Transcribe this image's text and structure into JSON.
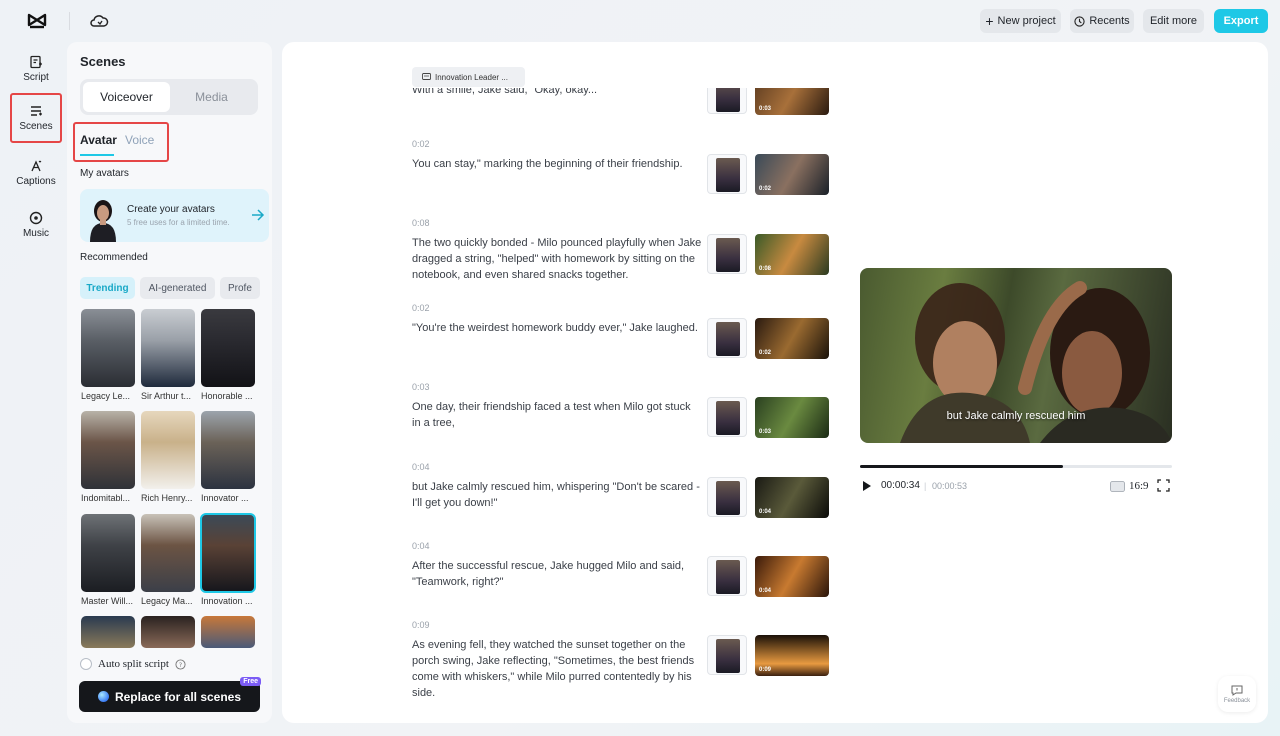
{
  "topbar": {
    "new_project": "New project",
    "recents": "Recents",
    "edit_more": "Edit more",
    "export": "Export"
  },
  "rail": {
    "script": "Script",
    "scenes": "Scenes",
    "captions": "Captions",
    "music": "Music"
  },
  "panel": {
    "title": "Scenes",
    "seg_voiceover": "Voiceover",
    "seg_media": "Media",
    "tab_avatar": "Avatar",
    "tab_voice": "Voice",
    "my_avatars": "My avatars",
    "create_title": "Create your avatars",
    "create_sub": "5 free uses for a limited time.",
    "recommended": "Recommended",
    "chips": [
      "Trending",
      "AI-generated",
      "Profe"
    ],
    "avatars": [
      "Legacy Le...",
      "Sir Arthur t...",
      "Honorable ...",
      "Indomitabl...",
      "Rich Henry...",
      "Innovator ...",
      "Master Will...",
      "Legacy Ma...",
      "Innovation ..."
    ],
    "auto_split": "Auto split script",
    "replace": "Replace for all scenes",
    "free": "Free"
  },
  "main": {
    "tag": "Innovation Leader ...",
    "scenes": [
      {
        "time": "",
        "text": "With a smile, Jake said, \"Okay, okay...",
        "dur": "0:03"
      },
      {
        "time": "0:02",
        "text": "You can stay,\" marking the beginning of their friendship.",
        "dur": "0:02"
      },
      {
        "time": "0:08",
        "text": "The two quickly bonded - Milo pounced playfully when Jake dragged a string, \"helped\" with homework by sitting on the notebook, and even shared snacks together.",
        "dur": "0:08"
      },
      {
        "time": "0:02",
        "text": "\"You're the weirdest homework buddy ever,\" Jake laughed.",
        "dur": "0:02"
      },
      {
        "time": "0:03",
        "text": "One day, their friendship faced a test when Milo got stuck in a tree,",
        "dur": "0:03"
      },
      {
        "time": "0:04",
        "text": "but Jake calmly rescued him, whispering \"Don't be scared - I'll get you down!\"",
        "dur": "0:04"
      },
      {
        "time": "0:04",
        "text": "After the successful rescue, Jake hugged Milo and said, \"Teamwork, right?\"",
        "dur": "0:04"
      },
      {
        "time": "0:09",
        "text": "As evening fell, they watched the sunset together on the porch swing, Jake reflecting, \"Sometimes, the best friends come with whiskers,\" while Milo purred contentedly by his side.",
        "dur": "0:09"
      }
    ]
  },
  "preview": {
    "subtitle": "but Jake calmly rescued him",
    "current": "00:00:34",
    "total": "00:00:53",
    "progress_fraction": 0.651,
    "ratio": "16:9"
  },
  "feedback": "Feedback",
  "colors": {
    "accent": "#1ec8e6",
    "highlight": "#e54646",
    "badge": "#7b5cf5"
  }
}
